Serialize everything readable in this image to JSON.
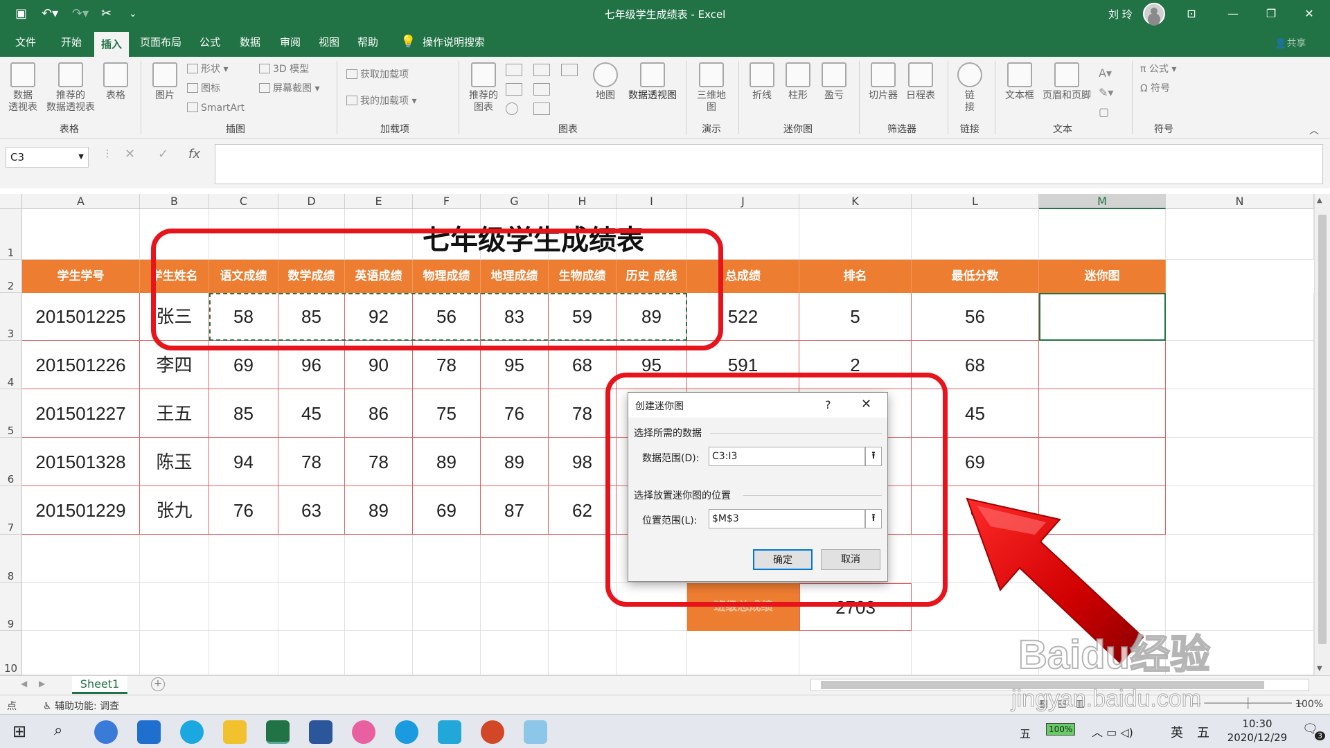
{
  "window": {
    "title": "七年级学生成绩表 - Excel",
    "user": "刘 玲"
  },
  "menu": [
    "文件",
    "开始",
    "插入",
    "页面布局",
    "公式",
    "数据",
    "审阅",
    "视图",
    "帮助",
    "操作说明搜索"
  ],
  "menu_active": "插入",
  "share": "共享",
  "ribbon": {
    "table_group": {
      "label": "表格",
      "pivot": "数据\n透视表",
      "rec_pivot": "推荐的\n数据透视表",
      "table": "表格"
    },
    "illustrations": {
      "label": "插图",
      "pictures": "图片",
      "shapes": "形状",
      "icons": "图标",
      "smartart": "SmartArt",
      "model3d": "3D 模型",
      "screenshot": "屏幕截图"
    },
    "addins": {
      "label": "加载项",
      "get": "获取加载项",
      "mine": "我的加载项"
    },
    "charts": {
      "label": "图表",
      "recommended": "推荐的\n图表",
      "maps": "地图",
      "pivotchart": "数据透视图"
    },
    "tours": {
      "label": "演示",
      "map3d": "三维地\n图"
    },
    "sparklines": {
      "label": "迷你图",
      "line": "折线",
      "column": "柱形",
      "winloss": "盈亏"
    },
    "filters": {
      "label": "筛选器",
      "slicer": "切片器",
      "timeline": "日程表"
    },
    "links": {
      "label": "链接",
      "link": "链\n接"
    },
    "text": {
      "label": "文本",
      "textbox": "文本框",
      "headerfooter": "页眉和页脚"
    },
    "symbols": {
      "label": "符号",
      "equation": "公式",
      "symbol": "符号"
    }
  },
  "namebox": "C3",
  "columns": [
    "A",
    "B",
    "C",
    "D",
    "E",
    "F",
    "G",
    "H",
    "I",
    "J",
    "K",
    "L",
    "M",
    "N"
  ],
  "rows": [
    "1",
    "2",
    "3",
    "4",
    "5",
    "6",
    "7",
    "8",
    "9",
    "10"
  ],
  "sheet_title": "七年级学生成绩表",
  "headers": [
    "学生学号",
    "学生姓名",
    "语文成绩",
    "数学成绩",
    "英语成绩",
    "物理成绩",
    "地理成绩",
    "生物成绩",
    "历史 成线",
    "总成绩",
    "排名",
    "最低分数",
    "迷你图"
  ],
  "students": [
    {
      "id": "201501225",
      "name": "张三",
      "scores": [
        "58",
        "85",
        "92",
        "56",
        "83",
        "59",
        "89"
      ],
      "total": "522",
      "rank": "5",
      "min": "56"
    },
    {
      "id": "201501226",
      "name": "李四",
      "scores": [
        "69",
        "96",
        "90",
        "78",
        "95",
        "68",
        "95"
      ],
      "total": "591",
      "rank": "2",
      "min": "68"
    },
    {
      "id": "201501227",
      "name": "王五",
      "scores": [
        "85",
        "45",
        "86",
        "75",
        "76",
        "78",
        ""
      ],
      "total": "",
      "rank": "",
      "min": "45"
    },
    {
      "id": "201501328",
      "name": "陈玉",
      "scores": [
        "94",
        "78",
        "78",
        "89",
        "89",
        "98",
        ""
      ],
      "total": "",
      "rank": "",
      "min": "69"
    },
    {
      "id": "201501229",
      "name": "张九",
      "scores": [
        "76",
        "63",
        "89",
        "69",
        "87",
        "62",
        ""
      ],
      "total": "",
      "rank": "",
      "min": "6"
    }
  ],
  "summary": {
    "label": "班级总成绩",
    "value": "2703"
  },
  "sheet_tab": "Sheet1",
  "status": {
    "mode": "点",
    "accessibility": "辅助功能: 调查",
    "zoom": "100%"
  },
  "dialog": {
    "title": "创建迷你图",
    "help": "?",
    "section1": "选择所需的数据",
    "range_label": "数据范围(D):",
    "range_value": "C3:I3",
    "section2": "选择放置迷你图的位置",
    "location_label": "位置范围(L):",
    "location_value": "$M$3",
    "ok": "确定",
    "cancel": "取消"
  },
  "taskbar": {
    "ime": "五",
    "battery": "100%",
    "lang": "英",
    "ime2": "五",
    "time": "10:30",
    "date": "2020/12/29",
    "notif": "3"
  },
  "watermark": {
    "brand": "Baidu经验",
    "url": "jingyan.baidu.com"
  },
  "colors": {
    "excel_green": "#217346",
    "header_orange": "#ed7d31",
    "annotation_red": "#e8141c"
  }
}
